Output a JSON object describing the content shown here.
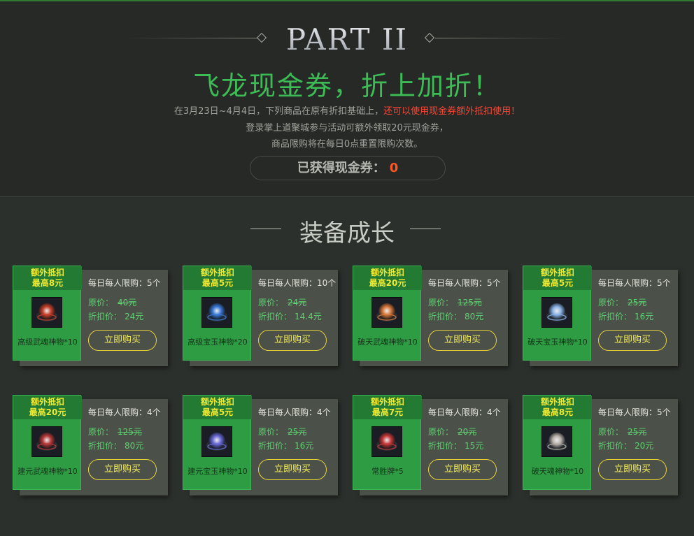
{
  "header": {
    "part_title": "PART II",
    "headline": "飞龙现金券，折上加折！",
    "desc_line1_a": "在3月23日~4月4日，下列商品在原有折扣基础上，",
    "desc_line1_b": "还可以使用现金券额外抵扣使用！",
    "desc_line2": "登录掌上道聚城参与活动可额外领取20元现金券，",
    "desc_line3": "商品限购将在每日0点重置限购次数。",
    "coupon_label": "已获得现金券：",
    "coupon_value": "0"
  },
  "section": {
    "title": "装备成长"
  },
  "labels": {
    "orig_label": "原价：",
    "disc_label": "折扣价：",
    "buy_label": "立即购买"
  },
  "colors": {
    "accent_green": "#2e9c43",
    "headline_green": "#3dbb55",
    "tag_yellow": "#f2ea32",
    "highlight_red": "#ff4433"
  },
  "products": [
    {
      "tag_line1": "额外抵扣",
      "tag_line2": "最高8元",
      "name": "高级武魂神物*10",
      "limit": "每日每人限购：5个",
      "orig_price": "40元",
      "disc_price": "24元",
      "icon": "red-soul-orb-icon",
      "icon_color": "#c8402a"
    },
    {
      "tag_line1": "额外抵扣",
      "tag_line2": "最高5元",
      "name": "高级宝玉神物*20",
      "limit": "每日每人限购：10个",
      "orig_price": "24元",
      "disc_price": "14.4元",
      "icon": "blue-jade-orb-icon",
      "icon_color": "#3a7ad8"
    },
    {
      "tag_line1": "额外抵扣",
      "tag_line2": "最高20元",
      "name": "破天武魂神物*10",
      "limit": "每日每人限购：5个",
      "orig_price": "125元",
      "disc_price": "80元",
      "icon": "orange-soul-orb-icon",
      "icon_color": "#d8783a"
    },
    {
      "tag_line1": "额外抵扣",
      "tag_line2": "最高5元",
      "name": "破天宝玉神物*10",
      "limit": "每日每人限购：5个",
      "orig_price": "25元",
      "disc_price": "16元",
      "icon": "white-jade-orb-icon",
      "icon_color": "#8ab4e8"
    },
    {
      "tag_line1": "额外抵扣",
      "tag_line2": "最高20元",
      "name": "建元武魂神物*10",
      "limit": "每日每人限购：4个",
      "orig_price": "125元",
      "disc_price": "80元",
      "icon": "crimson-soul-orb-icon",
      "icon_color": "#b83a3a"
    },
    {
      "tag_line1": "额外抵扣",
      "tag_line2": "最高5元",
      "name": "建元宝玉神物*10",
      "limit": "每日每人限购：4个",
      "orig_price": "25元",
      "disc_price": "16元",
      "icon": "purple-jade-orb-icon",
      "icon_color": "#6a6ad8"
    },
    {
      "tag_line1": "额外抵扣",
      "tag_line2": "最高7元",
      "name": "常胜牌*5",
      "limit": "每日每人限购：4个",
      "orig_price": "20元",
      "disc_price": "15元",
      "icon": "victory-token-icon",
      "icon_color": "#c83a3a"
    },
    {
      "tag_line1": "额外抵扣",
      "tag_line2": "最高8元",
      "name": "破天魂神物*10",
      "limit": "每日每人限购：5个",
      "orig_price": "25元",
      "disc_price": "20元",
      "icon": "silver-soul-orb-icon",
      "icon_color": "#b8b0a8"
    }
  ]
}
